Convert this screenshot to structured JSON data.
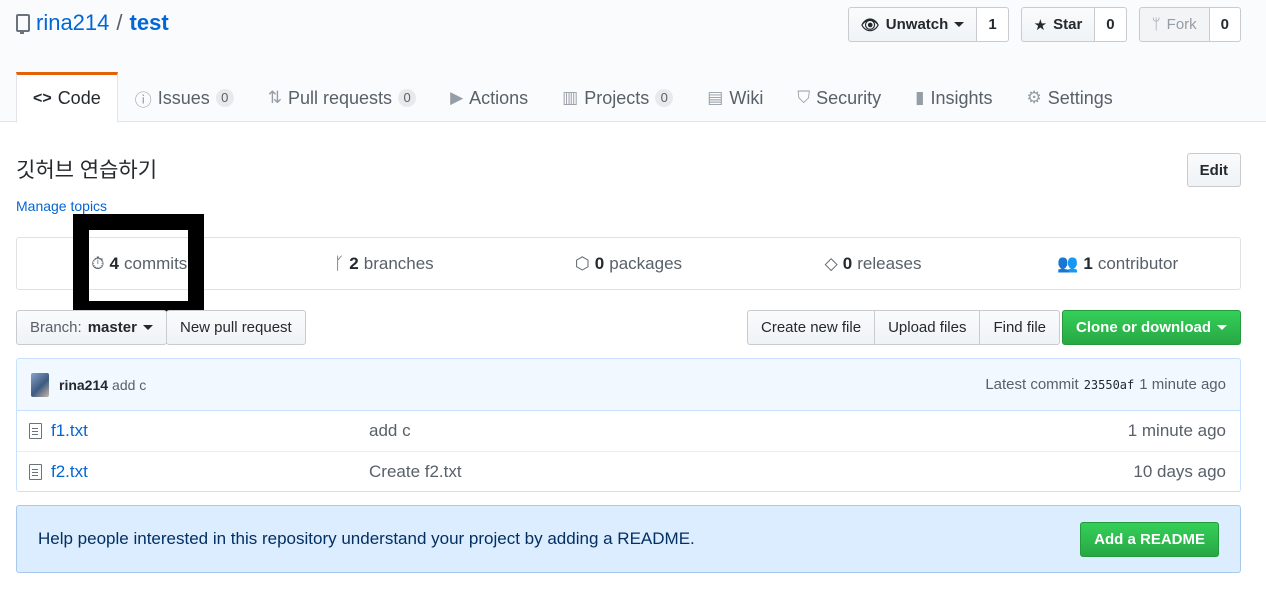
{
  "repo": {
    "owner": "rina214",
    "separator": "/",
    "name": "test"
  },
  "actions": {
    "watch": {
      "label": "Unwatch",
      "count": "1"
    },
    "star": {
      "label": "Star",
      "count": "0"
    },
    "fork": {
      "label": "Fork",
      "count": "0"
    }
  },
  "tabs": [
    {
      "label": "Code",
      "icon": "code-icon"
    },
    {
      "label": "Issues",
      "count": "0",
      "icon": "issue-icon"
    },
    {
      "label": "Pull requests",
      "count": "0",
      "icon": "pull-request-icon"
    },
    {
      "label": "Actions",
      "icon": "play-icon"
    },
    {
      "label": "Projects",
      "count": "0",
      "icon": "project-icon"
    },
    {
      "label": "Wiki",
      "icon": "book-icon"
    },
    {
      "label": "Security",
      "icon": "shield-icon"
    },
    {
      "label": "Insights",
      "icon": "graph-icon"
    },
    {
      "label": "Settings",
      "icon": "gear-icon"
    }
  ],
  "description": "깃허브 연습하기",
  "edit_label": "Edit",
  "manage_topics": "Manage topics",
  "numbers": {
    "commits": {
      "count": "4",
      "label": "commits"
    },
    "branches": {
      "count": "2",
      "label": "branches"
    },
    "packages": {
      "count": "0",
      "label": "packages"
    },
    "releases": {
      "count": "0",
      "label": "releases"
    },
    "contributors": {
      "count": "1",
      "label": "contributor"
    }
  },
  "file_nav": {
    "branch_prefix": "Branch:",
    "branch": "master",
    "new_pr": "New pull request",
    "create_file": "Create new file",
    "upload_files": "Upload files",
    "find_file": "Find file",
    "clone": "Clone or download"
  },
  "latest_commit": {
    "author": "rina214",
    "message": "add c",
    "prefix": "Latest commit",
    "sha": "23550af",
    "age": "1 minute ago"
  },
  "files": [
    {
      "name": "f1.txt",
      "message": "add c",
      "age": "1 minute ago"
    },
    {
      "name": "f2.txt",
      "message": "Create f2.txt",
      "age": "10 days ago"
    }
  ],
  "readme": {
    "text": "Help people interested in this repository understand your project by adding a README.",
    "button": "Add a README"
  },
  "colors": {
    "accent_tab": "#e36209",
    "link": "#0366d6",
    "primary_button": "#28a745",
    "readme_bg": "#dbedff"
  }
}
